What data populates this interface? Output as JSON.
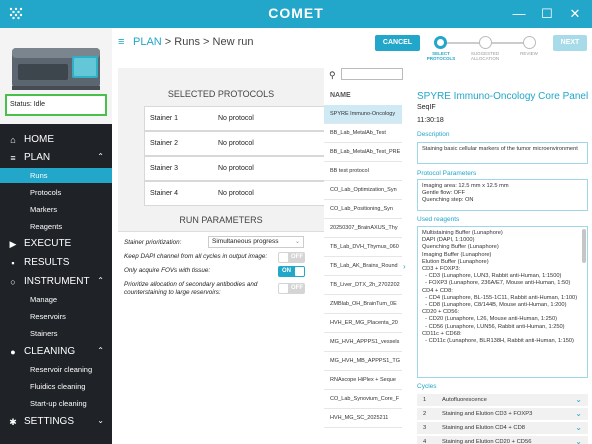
{
  "app": {
    "title": "COMET"
  },
  "window": {
    "minimize": "—",
    "maximize": "☐",
    "close": "✕"
  },
  "instrument": {
    "status": "Status:  Idle"
  },
  "nav": {
    "home": "HOME",
    "plan": "PLAN",
    "plan_items": [
      "Runs",
      "Protocols",
      "Markers",
      "Reagents"
    ],
    "execute": "EXECUTE",
    "results": "RESULTS",
    "instrument": "INSTRUMENT",
    "instrument_items": [
      "Manage",
      "Reservoirs",
      "Stainers"
    ],
    "cleaning": "CLEANING",
    "cleaning_items": [
      "Reservoir cleaning",
      "Fluidics cleaning",
      "Start-up cleaning"
    ],
    "settings": "SETTINGS"
  },
  "header": {
    "breadcrumb_accent": "PLAN",
    "breadcrumb_rest": " > Runs > New run",
    "cancel": "CANCEL",
    "next": "NEXT",
    "steps": [
      "SELECT PROTOCOLS",
      "SUGGESTED ALLOCATION",
      "REVIEW"
    ]
  },
  "selected_protocols": {
    "title": "SELECTED PROTOCOLS",
    "rows": [
      {
        "label": "Stainer 1",
        "value": "No protocol"
      },
      {
        "label": "Stainer 2",
        "value": "No protocol"
      },
      {
        "label": "Stainer 3",
        "value": "No protocol"
      },
      {
        "label": "Stainer 4",
        "value": "No protocol"
      }
    ]
  },
  "run_parameters": {
    "title": "RUN PARAMETERS",
    "prioritization_label": "Stainer prioritization:",
    "prioritization_value": "Simultaneous progress",
    "keep_dapi_label": "Keep DAPI channel from all cycles in output image:",
    "keep_dapi_state": "OFF",
    "fovs_label": "Only acquire FOVs with tissue:",
    "fovs_state": "ON",
    "prioritize_label": "Prioritize allocation of secondary antibodies and counterstaining to large reservoirs:",
    "prioritize_state": "OFF"
  },
  "protocol_list": {
    "header": "NAME",
    "items": [
      "SPYRE Immuno-Oncology",
      "BB_Lab_MetalAb_Test",
      "BB_Lab_MetalAb_Test_PRE",
      "BB test protocol",
      "CO_Lab_Optimization_Syn",
      "CO_Lab_Positioning_Syn",
      "20250307_BrainAXUS_Thy",
      "TB_Lab_DVH_Thymus_060",
      "TB_Lab_AK_Brains_Round",
      "TB_Liver_DTX_2h_2702202",
      "ZMBlab_OH_BrainTum_0E",
      "HVH_ER_MG_Placenta_20",
      "MG_HVH_APPPS1_vessels",
      "MG_HVH_MB_APPPS1_TG",
      "RNAscope HiPlex + Seque",
      "CO_Lab_Synovium_Core_F",
      "HVH_MG_SC_2025211"
    ]
  },
  "detail": {
    "title": "SPYRE Immuno-Oncology Core Panel",
    "instrument": "SeqIF",
    "duration": "11:30:18",
    "description_label": "Description",
    "description": "Staining basic cellular markers of the tumor microenvironment",
    "params_label": "Protocol Parameters",
    "params": [
      "Imaging area: 12.5 mm x 12.5 mm",
      "Gentle flow: OFF",
      "Quenching step: ON"
    ],
    "reagents_label": "Used reagents",
    "reagents": [
      "Multistaining Buffer (Lunaphore)",
      "DAPI (DAPI, 1:1000)",
      "Quenching Buffer (Lunaphore)",
      "Imaging Buffer (Lunaphore)",
      "Elution Buffer (Lunaphore)",
      "CD3 + FOXP3:",
      "  - CD3 (Lunaphore, LUN3, Rabbit anti-Human, 1:1500)",
      "  - FOXP3 (Lunaphore, 236A/E7, Mouse anti-Human, 1:50)",
      "CD4 + CD8:",
      "  - CD4 (Lunaphore, BL-155-1C11, Rabbit anti-Human, 1:100)",
      "  - CD8 (Lunaphore, C8/144B, Mouse anti-Human, 1:200)",
      "CD20 + CD56:",
      "  - CD20 (Lunaphore, L26, Mouse anti-Human, 1:250)",
      "  - CD56 (Lunaphore, LUN56, Rabbit anti-Human, 1:250)",
      "CD11c + CD68:",
      "  - CD11c (Lunaphore, BLR138H, Rabbit anti-Human, 1:150)"
    ],
    "cycles_label": "Cycles",
    "cycles": [
      {
        "num": "1",
        "name": "Autofluorescence"
      },
      {
        "num": "2",
        "name": "Staining and Elution CD3 + FOXP3"
      },
      {
        "num": "3",
        "name": "Staining and Elution CD4 + CD8"
      },
      {
        "num": "4",
        "name": "Staining and Elution CD20 + CD56"
      }
    ]
  },
  "colors": {
    "accent": "#22a6c9",
    "sidebar": "#1f2227",
    "status_border": "#48c04a"
  },
  "icons": [
    "app-logo-icon",
    "home-icon",
    "list-icon",
    "play-icon",
    "results-icon",
    "instrument-icon",
    "drop-icon",
    "gear-icon",
    "search-icon",
    "chevron-down-icon",
    "chevron-right-icon"
  ]
}
